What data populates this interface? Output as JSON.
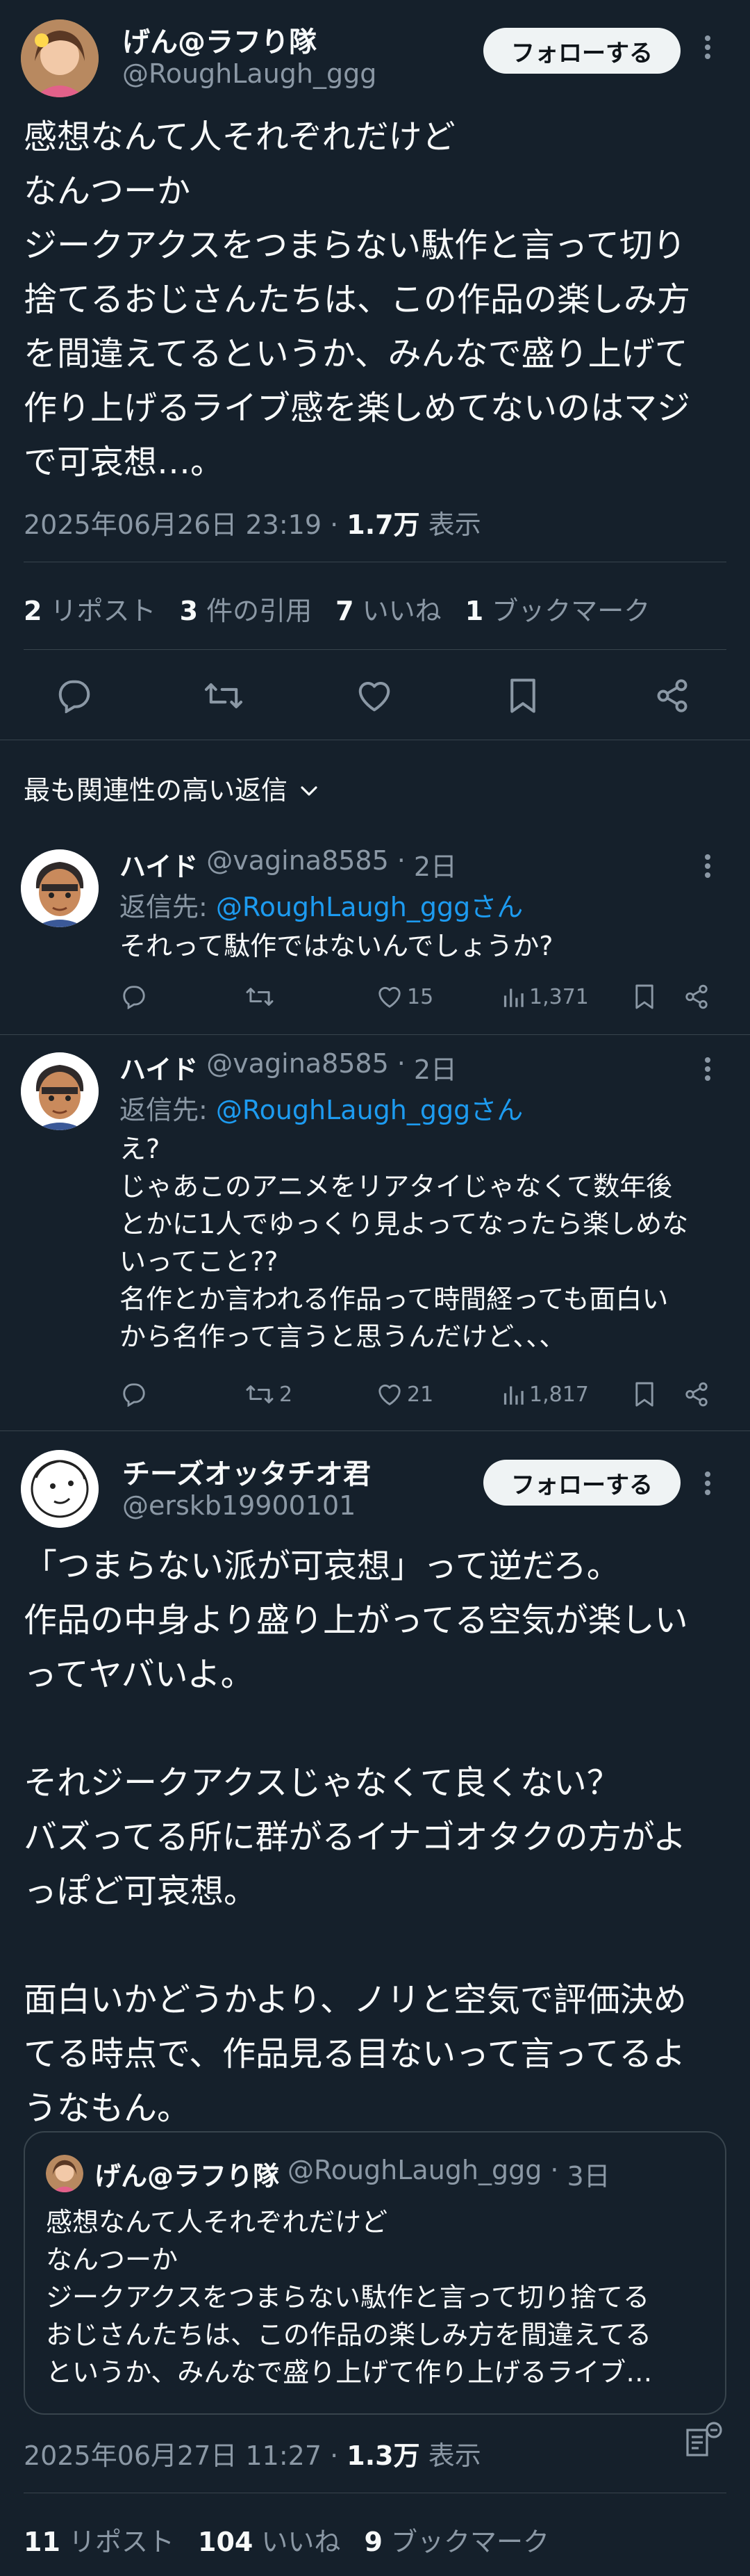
{
  "main_tweet": {
    "name": "げん@ラフり隊",
    "handle": "@RoughLaugh_ggg",
    "follow_label": "フォローする",
    "text_lines": [
      "感想なんて人それぞれだけど",
      "なんつーか",
      "ジークアクスをつまらない駄作と言って切り",
      "捨てるおじさんたちは、この作品の楽しみ方",
      "を間違えてるというか、みんなで盛り上げて",
      "作り上げるライブ感を楽しめてないのはマジ",
      "で可哀想…。"
    ],
    "timestamp": "2025年06月26日 23:19",
    "views": "1.7万",
    "views_label": "表示",
    "stats": {
      "reposts": "2",
      "reposts_label": "リポスト",
      "quotes": "3",
      "quotes_label": "件の引用",
      "likes": "7",
      "likes_label": "いいね",
      "bookmarks": "1",
      "bookmarks_label": "ブックマーク"
    }
  },
  "sort": {
    "label": "最も関連性の高い返信"
  },
  "replies": [
    {
      "name": "ハイド",
      "handle": "@vagina8585",
      "time": "2日",
      "reply_to_label": "返信先: ",
      "reply_to_handle": "@RoughLaugh_gggさん",
      "text": "それって駄作ではないんでしょうか?",
      "actions": {
        "reposts": "",
        "likes": "15",
        "views": "1,371"
      }
    },
    {
      "name": "ハイド",
      "handle": "@vagina8585",
      "time": "2日",
      "reply_to_label": "返信先: ",
      "reply_to_handle": "@RoughLaugh_gggさん",
      "text": "え?\nじゃあこのアニメをリアタイじゃなくて数年後\nとかに1人でゆっくり見よってなったら楽しめな\nいってこと??\n名作とか言われる作品って時間経っても面白い\nから名作って言うと思うんだけど、、、",
      "actions": {
        "reposts": "2",
        "likes": "21",
        "views": "1,817"
      }
    }
  ],
  "quote_tweet": {
    "name": "チーズオッタチオ君",
    "handle": "@erskb19900101",
    "follow_label": "フォローする",
    "text": "「つまらない派が可哀想」って逆だろ。\n作品の中身より盛り上がってる空気が楽しい\nってヤバいよ。\n\nそれジークアクスじゃなくて良くない？\nバズってる所に群がるイナゴオタクの方がよ\nっぽど可哀想。\n\n面白いかどうかより、ノリと空気で評価決め\nてる時点で、作品見る目ないって言ってるよ\nうなもん。",
    "quoted": {
      "name": "げん@ラフり隊",
      "handle": "@RoughLaugh_ggg",
      "time": "3日",
      "text": "感想なんて人それぞれだけど\nなんつーか\nジークアクスをつまらない駄作と言って切り捨てる\nおじさんたちは、この作品の楽しみ方を間違えてる\nというか、みんなで盛り上げて作り上げるライブ…"
    },
    "timestamp": "2025年06月27日 11:27",
    "views": "1.3万",
    "views_label": "表示",
    "stats": {
      "reposts": "11",
      "reposts_label": "リポスト",
      "likes": "104",
      "likes_label": "いいね",
      "bookmarks": "9",
      "bookmarks_label": "ブックマーク"
    }
  },
  "colors": {
    "background": "#15202b",
    "text": "#f7f9f9",
    "muted": "#8b98a5",
    "link": "#1d9bf0",
    "divider": "#38444d"
  }
}
